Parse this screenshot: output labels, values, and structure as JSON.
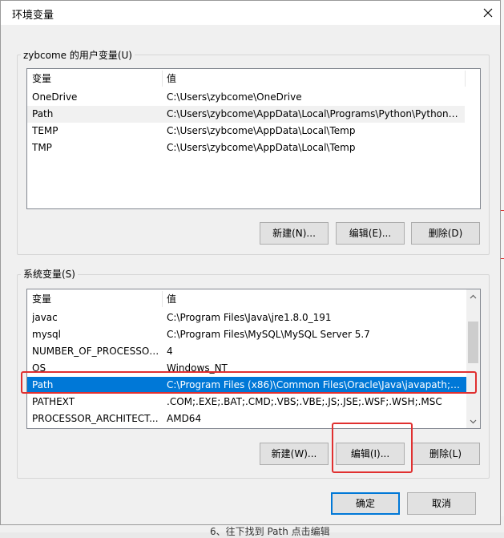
{
  "window": {
    "title": "环境变量",
    "close_icon": "close-icon"
  },
  "user_vars": {
    "group_label": "zybcome 的用户变量(U)",
    "columns": [
      "变量",
      "值"
    ],
    "rows": [
      {
        "name": "OneDrive",
        "value": "C:\\Users\\zybcome\\OneDrive"
      },
      {
        "name": "Path",
        "value": "C:\\Users\\zybcome\\AppData\\Local\\Programs\\Python\\Python3..."
      },
      {
        "name": "TEMP",
        "value": "C:\\Users\\zybcome\\AppData\\Local\\Temp"
      },
      {
        "name": "TMP",
        "value": "C:\\Users\\zybcome\\AppData\\Local\\Temp"
      }
    ],
    "buttons": {
      "new": "新建(N)...",
      "edit": "编辑(E)...",
      "delete": "删除(D)"
    }
  },
  "system_vars": {
    "group_label": "系统变量(S)",
    "columns": [
      "变量",
      "值"
    ],
    "rows": [
      {
        "name": "javac",
        "value": "C:\\Program Files\\Java\\jre1.8.0_191"
      },
      {
        "name": "mysql",
        "value": "C:\\Program Files\\MySQL\\MySQL Server 5.7"
      },
      {
        "name": "NUMBER_OF_PROCESSORS",
        "value": "4"
      },
      {
        "name": "OS",
        "value": "Windows_NT"
      },
      {
        "name": "Path",
        "value": "C:\\Program Files (x86)\\Common Files\\Oracle\\Java\\javapath;C:..."
      },
      {
        "name": "PATHEXT",
        "value": ".COM;.EXE;.BAT;.CMD;.VBS;.VBE;.JS;.JSE;.WSF;.WSH;.MSC"
      },
      {
        "name": "PROCESSOR_ARCHITECT...",
        "value": "AMD64"
      }
    ],
    "selected_row": "Path",
    "buttons": {
      "new": "新建(W)...",
      "edit": "编辑(I)...",
      "delete": "删除(L)"
    }
  },
  "footer": {
    "ok": "确定",
    "cancel": "取消"
  },
  "background": {
    "caption": "6、往下找到 Path 点击编辑"
  },
  "colors": {
    "selection": "#0078d7",
    "highlight": "#e03030"
  }
}
